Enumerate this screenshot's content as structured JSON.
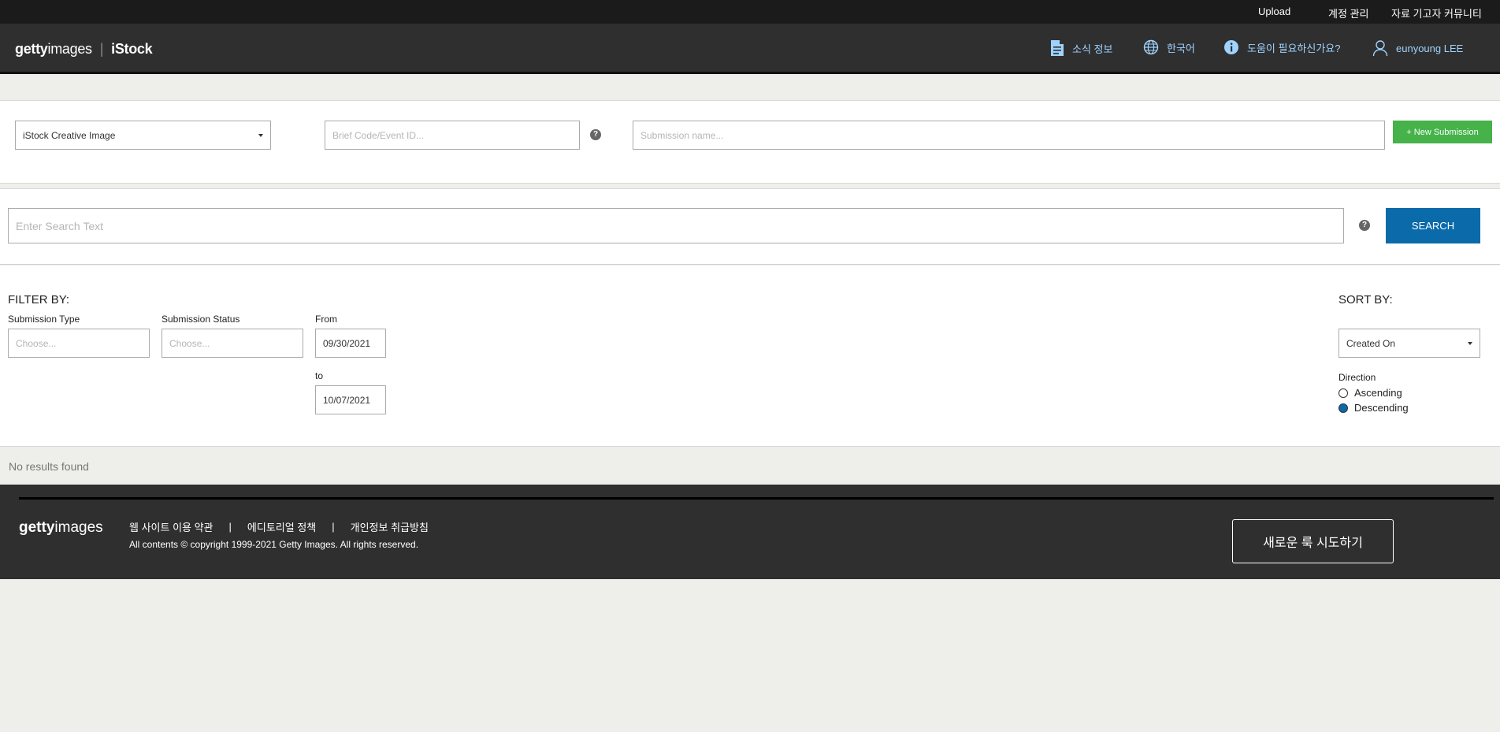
{
  "topbar": {
    "upload": "Upload",
    "account": "계정 관리",
    "community": "자료 기고자 커뮤니티"
  },
  "header": {
    "logo_getty_bold": "getty",
    "logo_getty_thin": "images",
    "logo_sep": "|",
    "logo_istock": "iStock",
    "news": "소식 정보",
    "language": "한국어",
    "help": "도움이 필요하신가요?",
    "user": "eunyoung LEE"
  },
  "submission": {
    "type_value": "iStock Creative Image",
    "brief_placeholder": "Brief Code/Event ID...",
    "name_placeholder": "Submission name...",
    "new_button": "+ New Submission"
  },
  "search": {
    "placeholder": "Enter Search Text",
    "button": "SEARCH"
  },
  "filter": {
    "title": "FILTER BY:",
    "type_label": "Submission Type",
    "type_placeholder": "Choose...",
    "status_label": "Submission Status",
    "status_placeholder": "Choose...",
    "from_label": "From",
    "from_value": "09/30/2021",
    "to_label": "to",
    "to_value": "10/07/2021"
  },
  "sort": {
    "title": "SORT BY:",
    "value": "Created On",
    "direction_label": "Direction",
    "ascending": "Ascending",
    "descending": "Descending",
    "selected": "Descending"
  },
  "results": {
    "empty": "No results found"
  },
  "footer": {
    "logo_bold": "getty",
    "logo_thin": "images",
    "terms": "웹 사이트 이용 약관",
    "editorial": "에디토리얼 정책",
    "privacy": "개인정보 취급방침",
    "copyright": "All contents © copyright 1999-2021 Getty Images. All rights reserved.",
    "try_new_look": "새로운 룩 시도하기"
  },
  "icons": [
    "document-icon",
    "globe-icon",
    "info-icon",
    "user-icon",
    "help-icon",
    "dropdown-caret-icon"
  ],
  "colors": {
    "accent_blue": "#0a6aaa",
    "green": "#45b34a",
    "header_bg": "#2f2f2f",
    "link_blue": "#9fd3ff"
  }
}
